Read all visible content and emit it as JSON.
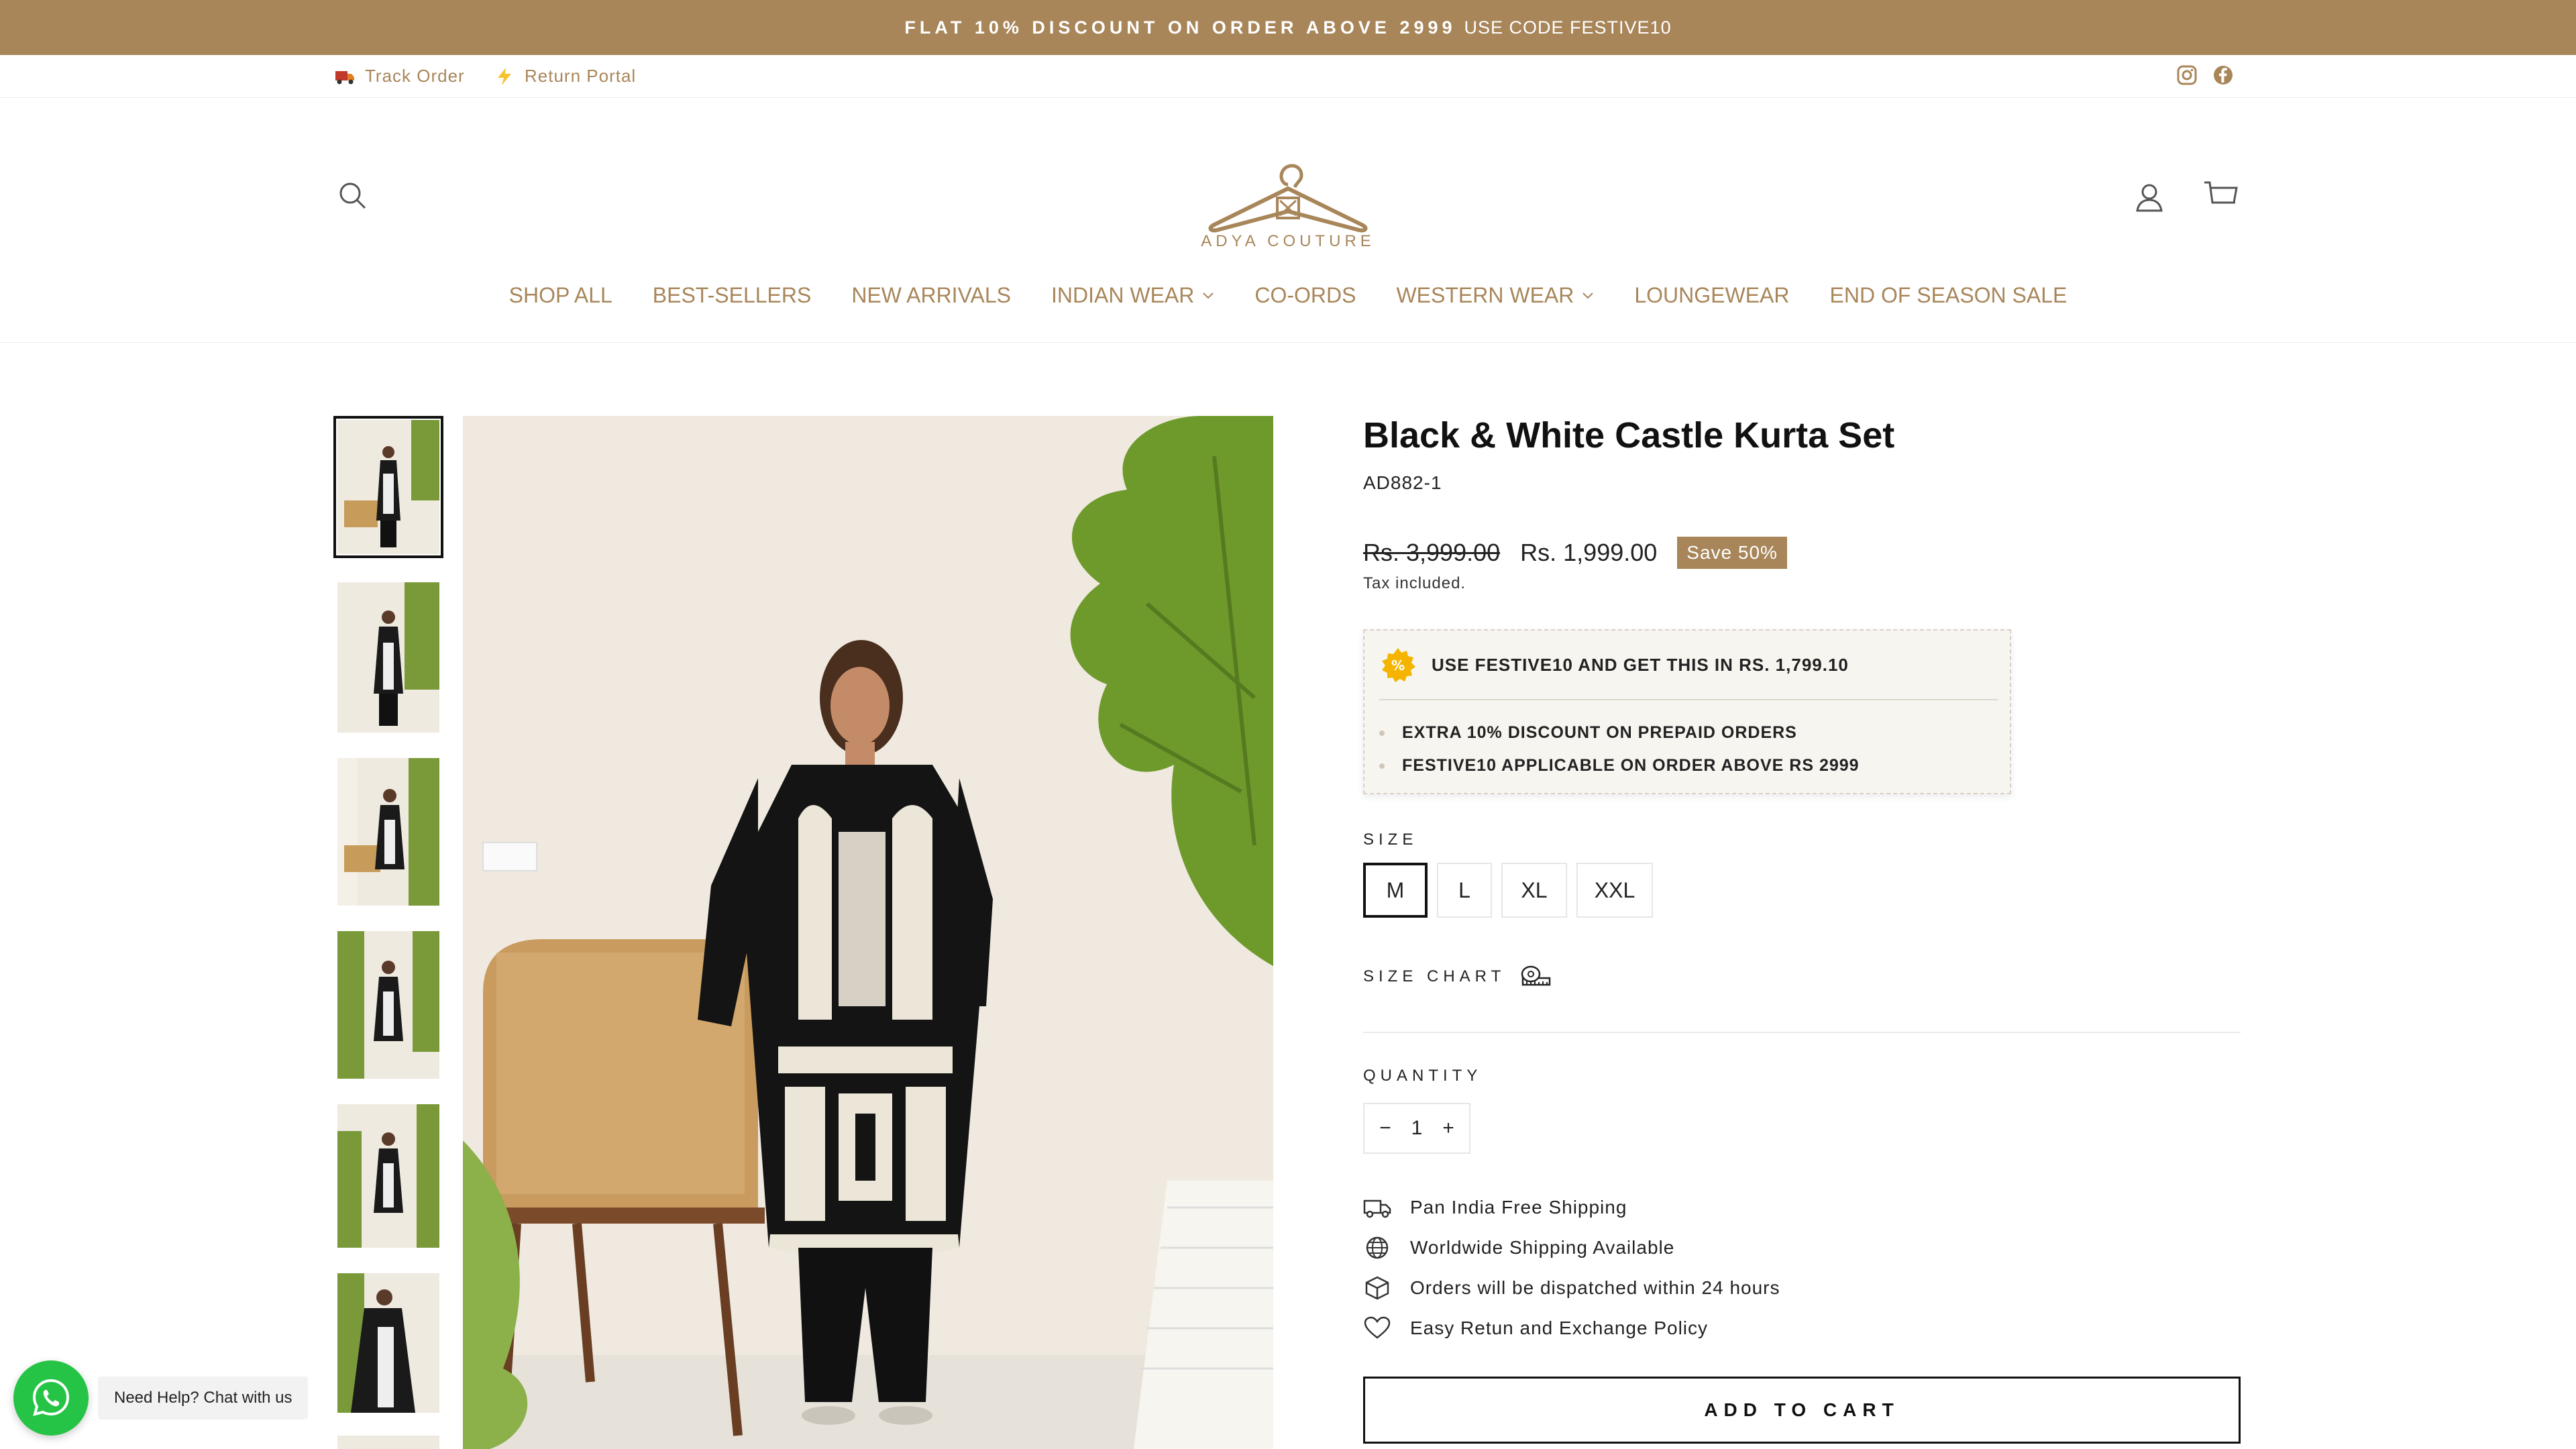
{
  "announcement": {
    "bold": "FLAT 10% DISCOUNT ON ORDER ABOVE 2999",
    "code": "USE CODE FESTIVE10"
  },
  "utility": {
    "track_order": "Track Order",
    "return_portal": "Return Portal",
    "social_icons": [
      "instagram-icon",
      "facebook-icon"
    ]
  },
  "brand": {
    "logo_text": "ADYA COUTURE",
    "accent": "#a8865a"
  },
  "nav": [
    {
      "label": "SHOP ALL",
      "dropdown": false
    },
    {
      "label": "BEST-SELLERS",
      "dropdown": false
    },
    {
      "label": "NEW ARRIVALS",
      "dropdown": false
    },
    {
      "label": "INDIAN WEAR",
      "dropdown": true
    },
    {
      "label": "CO-ORDS",
      "dropdown": false
    },
    {
      "label": "WESTERN WEAR",
      "dropdown": true
    },
    {
      "label": "LOUNGEWEAR",
      "dropdown": false
    },
    {
      "label": "END OF SEASON SALE",
      "dropdown": false
    }
  ],
  "product": {
    "title": "Black & White Castle Kurta Set",
    "sku": "AD882-1",
    "price_old": "Rs. 3,999.00",
    "price_new": "Rs. 1,999.00",
    "save_badge": "Save 50%",
    "tax_note": "Tax included.",
    "offer": {
      "headline": "USE FESTIVE10 AND GET THIS IN RS. 1,799.10",
      "bullets": [
        "EXTRA 10% DISCOUNT ON PREPAID ORDERS",
        "FESTIVE10 APPLICABLE ON ORDER ABOVE RS 2999"
      ]
    },
    "size_label": "SIZE",
    "sizes": [
      "M",
      "L",
      "XL",
      "XXL"
    ],
    "selected_size": "M",
    "size_chart_label": "SIZE CHART",
    "quantity_label": "QUANTITY",
    "quantity": "1",
    "features": [
      {
        "icon": "truck-icon",
        "text": "Pan India Free Shipping"
      },
      {
        "icon": "globe-icon",
        "text": "Worldwide Shipping Available"
      },
      {
        "icon": "box-icon",
        "text": "Orders will be dispatched within 24 hours"
      },
      {
        "icon": "heart-icon",
        "text": "Easy Retun and Exchange Policy"
      }
    ],
    "add_to_cart": "ADD TO CART"
  },
  "whatsapp": {
    "label": "Need Help? Chat with us"
  }
}
